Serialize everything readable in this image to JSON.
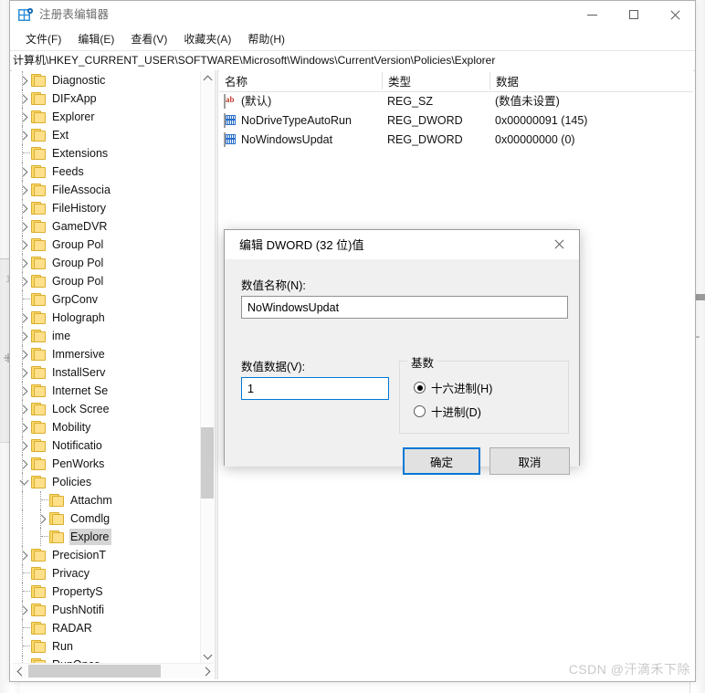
{
  "window": {
    "title": "注册表编辑器",
    "icon": "registry-editor-icon",
    "minimize_label": "最小化",
    "maximize_label": "最大化",
    "close_label": "关闭"
  },
  "menubar": {
    "items": [
      {
        "label": "文件(F)",
        "name": "menu-file"
      },
      {
        "label": "编辑(E)",
        "name": "menu-edit"
      },
      {
        "label": "查看(V)",
        "name": "menu-view"
      },
      {
        "label": "收藏夹(A)",
        "name": "menu-favorites"
      },
      {
        "label": "帮助(H)",
        "name": "menu-help"
      }
    ]
  },
  "address": {
    "path": "计算机\\HKEY_CURRENT_USER\\SOFTWARE\\Microsoft\\Windows\\CurrentVersion\\Policies\\Explorer"
  },
  "tree": {
    "items": [
      {
        "label": "Diagnostic",
        "depth": 1,
        "expander": "collapsed",
        "selected": false
      },
      {
        "label": "DIFxApp",
        "depth": 1,
        "expander": "collapsed",
        "selected": false
      },
      {
        "label": "Explorer",
        "depth": 1,
        "expander": "collapsed",
        "selected": false
      },
      {
        "label": "Ext",
        "depth": 1,
        "expander": "collapsed",
        "selected": false
      },
      {
        "label": "Extensions",
        "depth": 1,
        "expander": "none",
        "selected": false
      },
      {
        "label": "Feeds",
        "depth": 1,
        "expander": "collapsed",
        "selected": false
      },
      {
        "label": "FileAssocia",
        "depth": 1,
        "expander": "collapsed",
        "selected": false
      },
      {
        "label": "FileHistory",
        "depth": 1,
        "expander": "collapsed",
        "selected": false
      },
      {
        "label": "GameDVR",
        "depth": 1,
        "expander": "collapsed",
        "selected": false
      },
      {
        "label": "Group Pol",
        "depth": 1,
        "expander": "collapsed",
        "selected": false
      },
      {
        "label": "Group Pol",
        "depth": 1,
        "expander": "collapsed",
        "selected": false
      },
      {
        "label": "Group Pol",
        "depth": 1,
        "expander": "collapsed",
        "selected": false
      },
      {
        "label": "GrpConv",
        "depth": 1,
        "expander": "none",
        "selected": false
      },
      {
        "label": "Holograph",
        "depth": 1,
        "expander": "collapsed",
        "selected": false
      },
      {
        "label": "ime",
        "depth": 1,
        "expander": "collapsed",
        "selected": false
      },
      {
        "label": "Immersive",
        "depth": 1,
        "expander": "collapsed",
        "selected": false
      },
      {
        "label": "InstallServ",
        "depth": 1,
        "expander": "collapsed",
        "selected": false
      },
      {
        "label": "Internet Se",
        "depth": 1,
        "expander": "collapsed",
        "selected": false
      },
      {
        "label": "Lock Scree",
        "depth": 1,
        "expander": "collapsed",
        "selected": false
      },
      {
        "label": "Mobility",
        "depth": 1,
        "expander": "collapsed",
        "selected": false
      },
      {
        "label": "Notificatio",
        "depth": 1,
        "expander": "collapsed",
        "selected": false
      },
      {
        "label": "PenWorks",
        "depth": 1,
        "expander": "collapsed",
        "selected": false
      },
      {
        "label": "Policies",
        "depth": 1,
        "expander": "expanded",
        "selected": false
      },
      {
        "label": "Attachm",
        "depth": 2,
        "expander": "none",
        "selected": false
      },
      {
        "label": "Comdlg",
        "depth": 2,
        "expander": "collapsed",
        "selected": false
      },
      {
        "label": "Explore",
        "depth": 2,
        "expander": "none",
        "selected": true
      },
      {
        "label": "PrecisionT",
        "depth": 1,
        "expander": "collapsed",
        "selected": false
      },
      {
        "label": "Privacy",
        "depth": 1,
        "expander": "none",
        "selected": false
      },
      {
        "label": "PropertyS",
        "depth": 1,
        "expander": "none",
        "selected": false
      },
      {
        "label": "PushNotifi",
        "depth": 1,
        "expander": "collapsed",
        "selected": false
      },
      {
        "label": "RADAR",
        "depth": 1,
        "expander": "none",
        "selected": false
      },
      {
        "label": "Run",
        "depth": 1,
        "expander": "none",
        "selected": false
      },
      {
        "label": "RunOnce",
        "depth": 1,
        "expander": "none",
        "selected": false
      }
    ]
  },
  "list": {
    "columns": [
      {
        "label": "名称",
        "name": "column-name"
      },
      {
        "label": "类型",
        "name": "column-type"
      },
      {
        "label": "数据",
        "name": "column-data"
      }
    ],
    "rows": [
      {
        "icon": "string-value-icon",
        "name": "(默认)",
        "type": "REG_SZ",
        "data": "(数值未设置)"
      },
      {
        "icon": "dword-value-icon",
        "name": "NoDriveTypeAutoRun",
        "type": "REG_DWORD",
        "data": "0x00000091 (145)"
      },
      {
        "icon": "dword-value-icon",
        "name": "NoWindowsUpdat",
        "type": "REG_DWORD",
        "data": "0x00000000 (0)"
      }
    ]
  },
  "dialog": {
    "title": "编辑 DWORD (32 位)值",
    "close_label": "关闭",
    "value_name_label": "数值名称(N):",
    "value_name_accel": "N",
    "value_name": "NoWindowsUpdat",
    "value_data_label": "数值数据(V):",
    "value_data_accel": "V",
    "value_data": "1",
    "base_group_label": "基数",
    "radios": [
      {
        "label": "十六进制(H)",
        "checked": true,
        "name": "radio-hexadecimal"
      },
      {
        "label": "十进制(D)",
        "checked": false,
        "name": "radio-decimal"
      }
    ],
    "ok_label": "确定",
    "cancel_label": "取消"
  },
  "watermark": {
    "text": "CSDN @汗滴禾下除"
  },
  "background": {
    "left_glyph": "1",
    "right_glyph": "⌐"
  },
  "colors": {
    "accent": "#0078d7",
    "folder": "#ffe08a",
    "selection": "#d5d5d5",
    "dword_icon": "#2a6fc9",
    "string_icon": "#c0392b"
  }
}
